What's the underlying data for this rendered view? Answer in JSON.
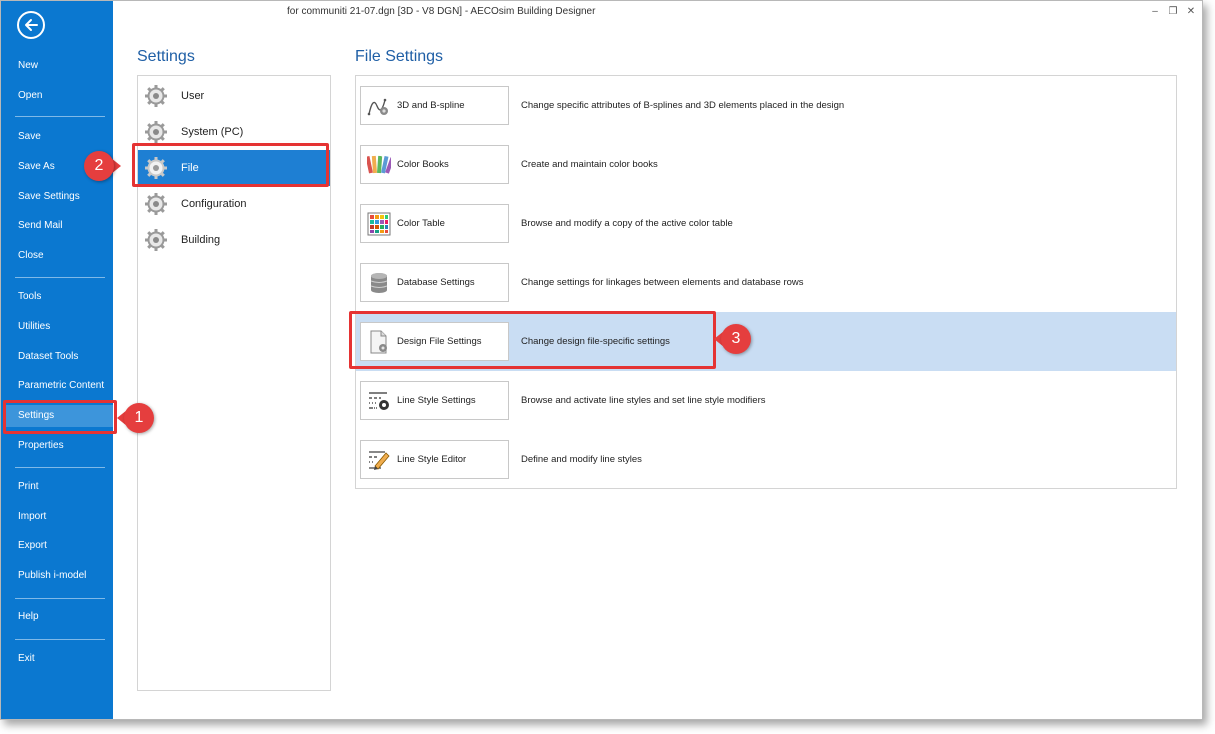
{
  "window": {
    "title": "for communiti 21-07.dgn [3D - V8 DGN] - AECOsim Building Designer",
    "controls": {
      "minimize": "–",
      "restore": "❐",
      "close": "✕"
    }
  },
  "sidebar": {
    "items": [
      {
        "label": "New"
      },
      {
        "label": "Open"
      },
      {
        "label": "Save"
      },
      {
        "label": "Save As"
      },
      {
        "label": "Save Settings"
      },
      {
        "label": "Send Mail"
      },
      {
        "label": "Close"
      },
      {
        "label": "Tools"
      },
      {
        "label": "Utilities"
      },
      {
        "label": "Dataset Tools"
      },
      {
        "label": "Parametric Content"
      },
      {
        "label": "Settings"
      },
      {
        "label": "Properties"
      },
      {
        "label": "Print"
      },
      {
        "label": "Import"
      },
      {
        "label": "Export"
      },
      {
        "label": "Publish i-model"
      },
      {
        "label": "Help"
      },
      {
        "label": "Exit"
      }
    ],
    "active": "Settings"
  },
  "settings": {
    "heading": "Settings",
    "categories": [
      {
        "label": "User"
      },
      {
        "label": "System (PC)"
      },
      {
        "label": "File"
      },
      {
        "label": "Configuration"
      },
      {
        "label": "Building"
      }
    ],
    "selected": "File"
  },
  "file_settings": {
    "heading": "File Settings",
    "rows": [
      {
        "button": "3D and B-spline",
        "icon": "bspline-icon",
        "description": "Change specific attributes of B-splines and 3D elements placed in the design"
      },
      {
        "button": "Color Books",
        "icon": "color-books-icon",
        "description": "Create and maintain color books"
      },
      {
        "button": "Color Table",
        "icon": "color-table-icon",
        "description": "Browse and modify a copy of the active color table"
      },
      {
        "button": "Database Settings",
        "icon": "database-icon",
        "description": "Change settings for linkages between elements and database rows"
      },
      {
        "button": "Design File Settings",
        "icon": "design-file-icon",
        "description": "Change design file-specific settings"
      },
      {
        "button": "Line Style Settings",
        "icon": "line-style-settings-icon",
        "description": "Browse and activate line styles and set line style modifiers"
      },
      {
        "button": "Line Style Editor",
        "icon": "line-style-editor-icon",
        "description": "Define and modify line styles"
      }
    ],
    "selected": "Design File Settings"
  },
  "callouts": {
    "one": "1",
    "two": "2",
    "three": "3"
  },
  "colors": {
    "sidebar": "#0b78d0",
    "selected": "#1e7fd3",
    "row_highlight": "#c9ddf3",
    "highlight_red": "#e53333"
  }
}
